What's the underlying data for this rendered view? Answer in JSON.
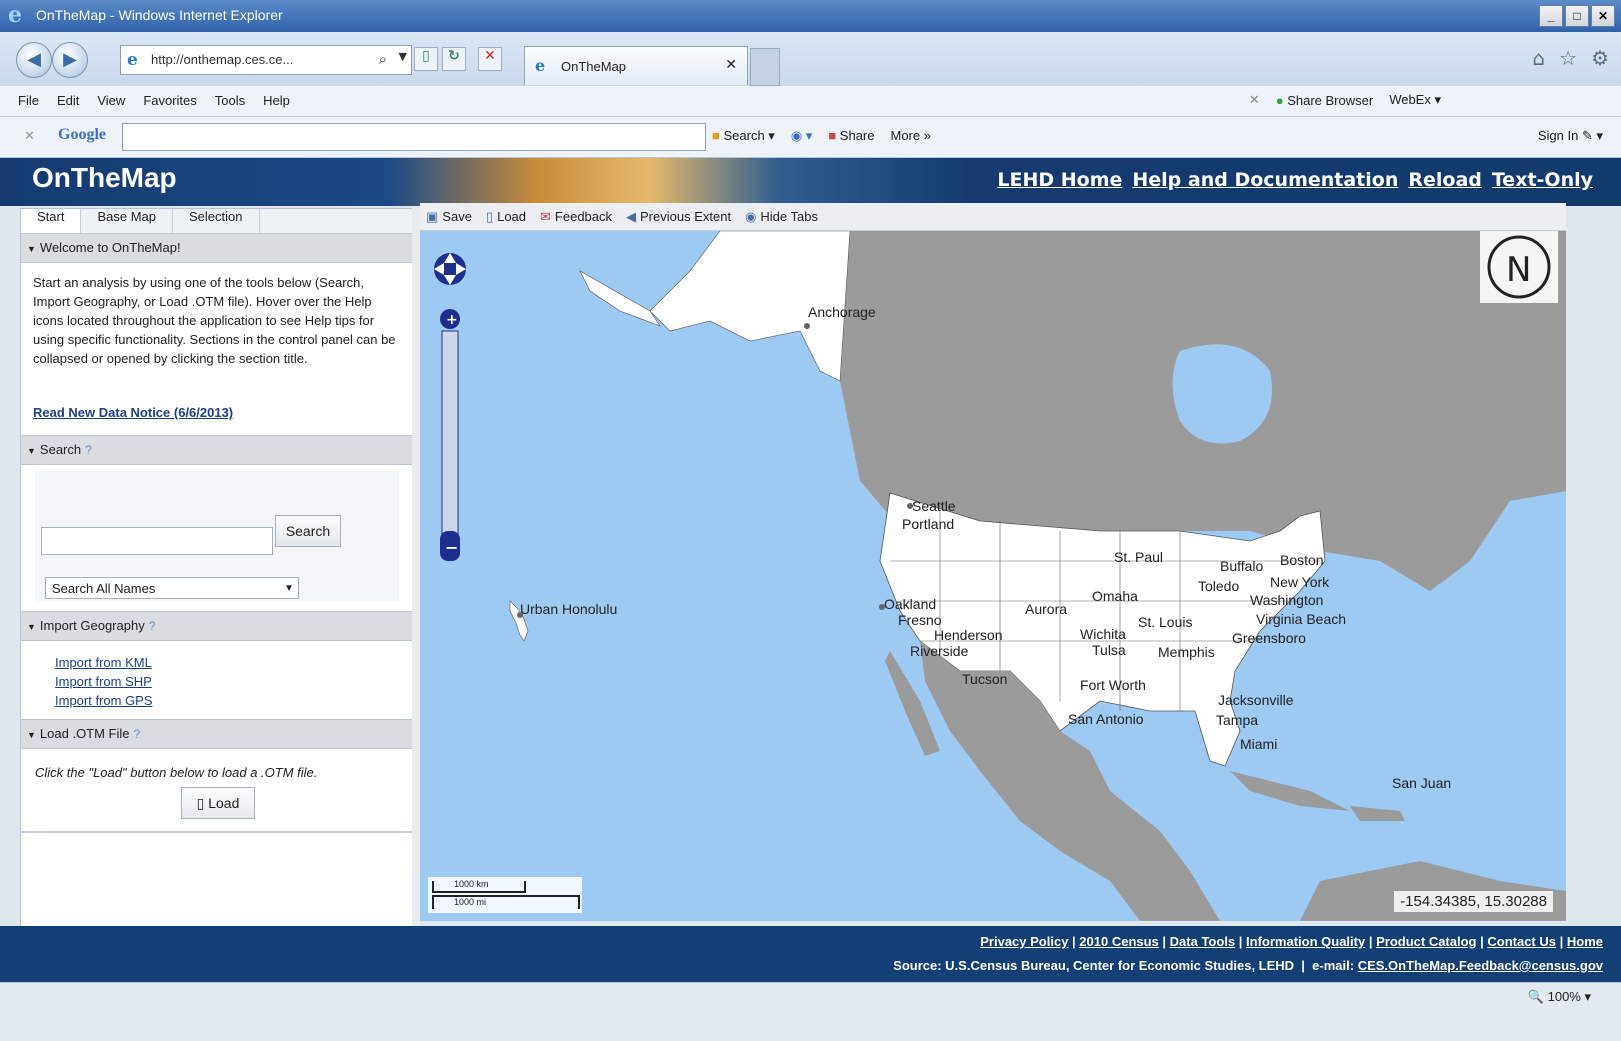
{
  "window": {
    "title": "OnTheMap - Windows Internet Explorer"
  },
  "browser": {
    "url": "http://onthemap.ces.ce...",
    "tab_title": "OnTheMap",
    "menu": [
      "File",
      "Edit",
      "View",
      "Favorites",
      "Tools",
      "Help"
    ],
    "share_browser": "Share Browser",
    "webex": "WebEx",
    "google_toolbar": {
      "search": "Search",
      "share": "Share",
      "more": "More »",
      "sign_in": "Sign In"
    },
    "zoom": "100%"
  },
  "app": {
    "title": "OnTheMap",
    "header_links": [
      "LEHD Home",
      "Help and Documentation",
      "Reload",
      "Text-Only"
    ]
  },
  "left_panel": {
    "tabs": [
      "Start",
      "Base Map",
      "Selection"
    ],
    "welcome": {
      "heading": "Welcome to OnTheMap!",
      "body": "Start an analysis by using one of the tools below (Search, Import Geography, or Load .OTM file). Hover over the Help icons located throughout the application to see Help tips for using specific functionality. Sections in the control panel can be collapsed or opened by clicking the section title.",
      "notice_link": "Read New Data Notice (6/6/2013)"
    },
    "search": {
      "heading": "Search",
      "button": "Search",
      "input_value": "",
      "select_value": "Search All Names"
    },
    "import": {
      "heading": "Import Geography",
      "links": [
        "Import from KML",
        "Import from SHP",
        "Import from GPS"
      ]
    },
    "load": {
      "heading": "Load .OTM File",
      "text": "Click the \"Load\" button below to load a .OTM file.",
      "button": "Load"
    }
  },
  "map_toolbar": [
    "Save",
    "Load",
    "Feedback",
    "Previous Extent",
    "Hide Tabs"
  ],
  "map": {
    "cities": [
      "Anchorage",
      "Seattle",
      "Portland",
      "Oakland",
      "Fresno",
      "Henderson",
      "Riverside",
      "Tucson",
      "Aurora",
      "Omaha",
      "St. Paul",
      "Wichita",
      "Tulsa",
      "Memphis",
      "St. Louis",
      "Fort Worth",
      "San Antonio",
      "Toledo",
      "Buffalo",
      "Boston",
      "New York",
      "Washington",
      "Virginia Beach",
      "Greensboro",
      "Jacksonville",
      "Tampa",
      "Miami",
      "Urban Honolulu",
      "San Juan"
    ],
    "coordinates": "-154.34385, 15.30288",
    "scale": {
      "km": "1000 km",
      "mi": "1000 mi"
    },
    "north": "N"
  },
  "footer": {
    "links": [
      "Privacy Policy",
      "2010 Census",
      "Data Tools",
      "Information Quality",
      "Product Catalog",
      "Contact Us",
      "Home"
    ],
    "source_text": "Source: U.S.Census Bureau, Center for Economic Studies, LEHD",
    "email_label": "e-mail:",
    "email": "CES.OnTheMap.Feedback@census.gov"
  }
}
